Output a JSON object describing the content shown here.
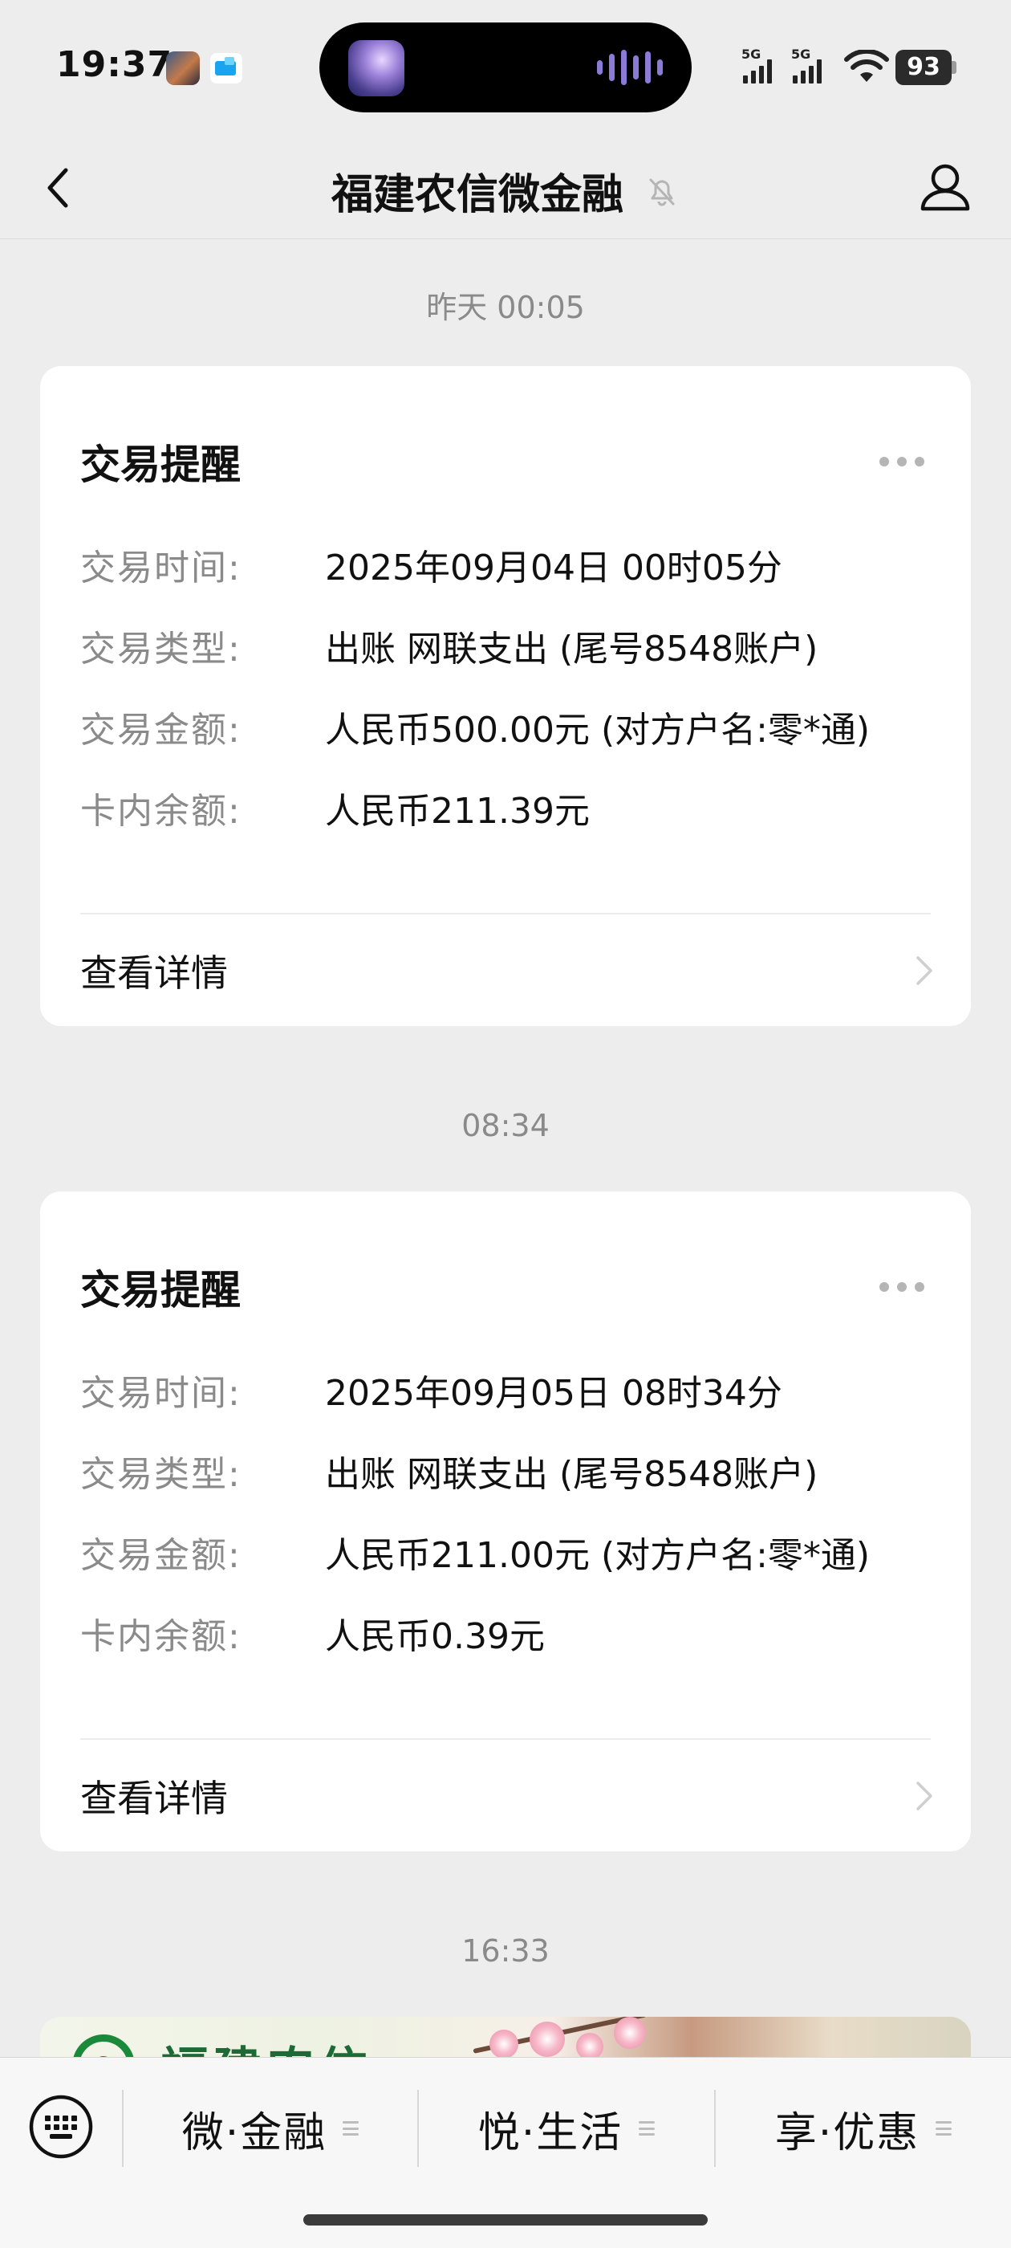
{
  "status_bar": {
    "time": "19:37",
    "signal_1_label": "5G",
    "signal_2_label": "5G",
    "battery": "93"
  },
  "header": {
    "title": "福建农信微金融"
  },
  "messages": [
    {
      "timestamp": "昨天 00:05",
      "title": "交易提醒",
      "rows": [
        {
          "label": "交易时间:",
          "value": "2025年09月04日 00时05分"
        },
        {
          "label": "交易类型:",
          "value": "出账  网联支出 (尾号8548账户)"
        },
        {
          "label": "交易金额:",
          "value": "人民币500.00元 (对方户名:零*通)"
        },
        {
          "label": "卡内余额:",
          "value": "人民币211.39元"
        }
      ],
      "detail_label": "查看详情"
    },
    {
      "timestamp": "08:34",
      "title": "交易提醒",
      "rows": [
        {
          "label": "交易时间:",
          "value": "2025年09月05日 08时34分"
        },
        {
          "label": "交易类型:",
          "value": "出账  网联支出 (尾号8548账户)"
        },
        {
          "label": "交易金额:",
          "value": "人民币211.00元 (对方户名:零*通)"
        },
        {
          "label": "卡内余额:",
          "value": "人民币0.39元"
        }
      ],
      "detail_label": "查看详情"
    }
  ],
  "third_timestamp": "16:33",
  "banner": {
    "text": "福建农信"
  },
  "bottom_menu": {
    "items": [
      {
        "label": "微·金融"
      },
      {
        "label": "悦·生活"
      },
      {
        "label": "享·优惠"
      }
    ]
  },
  "colors": {
    "background": "#ededed",
    "card": "#ffffff",
    "label_gray": "#8a8a8a",
    "brand_green": "#1a8a3a"
  }
}
